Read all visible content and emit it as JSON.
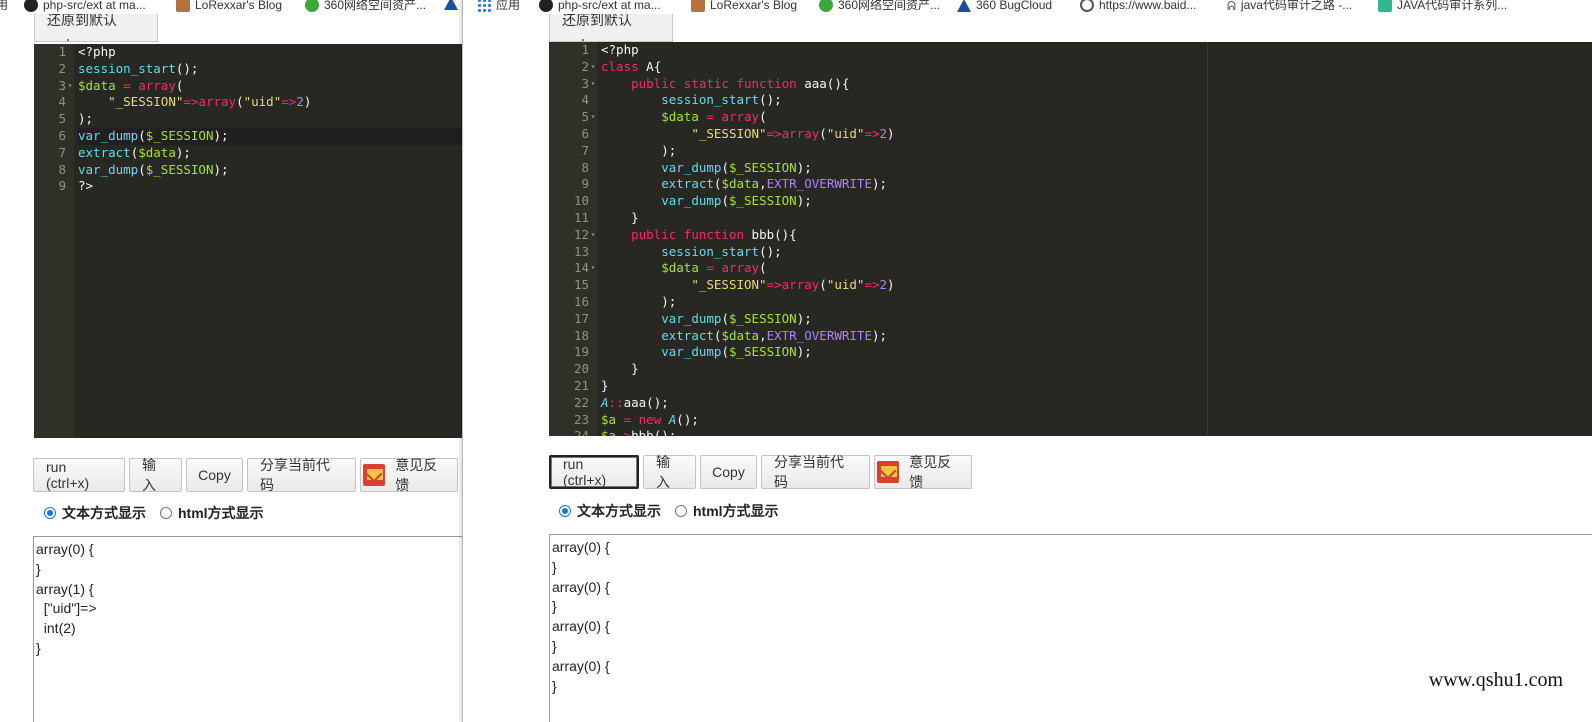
{
  "left": {
    "bookmarks": [
      {
        "label": "用",
        "icon": "none"
      },
      {
        "label": "php-src/ext at ma...",
        "icon": "github-icon"
      },
      {
        "label": "LoRexxar's Blog",
        "icon": "blog-icon"
      },
      {
        "label": "360网络空间资产...",
        "icon": "360-icon"
      },
      {
        "label": "",
        "icon": "bugcloud-icon"
      }
    ],
    "restore_label": "还原到默认code",
    "code_lines": [
      [
        {
          "t": "plain",
          "s": "<?php"
        }
      ],
      [
        {
          "t": "fn",
          "s": "session_start"
        },
        {
          "t": "plain",
          "s": "();"
        }
      ],
      [
        {
          "t": "var",
          "s": "$data"
        },
        {
          "t": "plain",
          "s": " "
        },
        {
          "t": "kw",
          "s": "="
        },
        {
          "t": "plain",
          "s": " "
        },
        {
          "t": "kw",
          "s": "array"
        },
        {
          "t": "plain",
          "s": "("
        }
      ],
      [
        {
          "t": "plain",
          "s": "    "
        },
        {
          "t": "str",
          "s": "\"_SESSION\""
        },
        {
          "t": "kw",
          "s": "=>"
        },
        {
          "t": "kw",
          "s": "array"
        },
        {
          "t": "plain",
          "s": "("
        },
        {
          "t": "str",
          "s": "\"uid\""
        },
        {
          "t": "kw",
          "s": "=>"
        },
        {
          "t": "num",
          "s": "2"
        },
        {
          "t": "plain",
          "s": ")"
        }
      ],
      [
        {
          "t": "plain",
          "s": ");"
        }
      ],
      [
        {
          "t": "fn",
          "s": "var_dump"
        },
        {
          "t": "plain",
          "s": "("
        },
        {
          "t": "var",
          "s": "$_SESSION"
        },
        {
          "t": "plain",
          "s": ");"
        }
      ],
      [
        {
          "t": "fn",
          "s": "extract"
        },
        {
          "t": "plain",
          "s": "("
        },
        {
          "t": "var",
          "s": "$data"
        },
        {
          "t": "plain",
          "s": ");"
        }
      ],
      [
        {
          "t": "fn",
          "s": "var_dump"
        },
        {
          "t": "plain",
          "s": "("
        },
        {
          "t": "var",
          "s": "$_SESSION"
        },
        {
          "t": "plain",
          "s": ");"
        }
      ],
      [
        {
          "t": "plain",
          "s": "?>"
        }
      ]
    ],
    "fold_lines": [
      3
    ],
    "active_line": 6,
    "buttons": {
      "run": "run (ctrl+x)",
      "input": "输入",
      "copy": "Copy",
      "share": "分享当前代码",
      "feedback": "意见反馈"
    },
    "radio": {
      "text": "文本方式显示",
      "html": "html方式显示",
      "selected": "text"
    },
    "output_lines": [
      "array(0) {",
      "}",
      "array(1) {",
      "  [\"uid\"]=>",
      "  int(2)",
      "}"
    ]
  },
  "right": {
    "bookmarks": [
      {
        "label": "应用",
        "icon": "apps-icon"
      },
      {
        "label": "php-src/ext at ma...",
        "icon": "github-icon"
      },
      {
        "label": "LoRexxar's Blog",
        "icon": "blog-icon"
      },
      {
        "label": "360网络空间资产...",
        "icon": "360-icon"
      },
      {
        "label": "360 BugCloud",
        "icon": "bugcloud-icon"
      },
      {
        "label": "https://www.baid...",
        "icon": "globe-icon"
      },
      {
        "label": "java代码审计之路 -...",
        "icon": "java-icon"
      },
      {
        "label": "JAVA代码审计系列...",
        "icon": "doc-icon"
      }
    ],
    "restore_label": "还原到默认code",
    "code_lines": [
      [
        {
          "t": "plain",
          "s": "<?php"
        }
      ],
      [
        {
          "t": "kw",
          "s": "class"
        },
        {
          "t": "plain",
          "s": " A{"
        }
      ],
      [
        {
          "t": "plain",
          "s": "    "
        },
        {
          "t": "kw",
          "s": "public"
        },
        {
          "t": "plain",
          "s": " "
        },
        {
          "t": "kw",
          "s": "static"
        },
        {
          "t": "plain",
          "s": " "
        },
        {
          "t": "kw",
          "s": "function"
        },
        {
          "t": "plain",
          "s": " aaa(){"
        }
      ],
      [
        {
          "t": "plain",
          "s": "        "
        },
        {
          "t": "fn",
          "s": "session_start"
        },
        {
          "t": "plain",
          "s": "();"
        }
      ],
      [
        {
          "t": "plain",
          "s": "        "
        },
        {
          "t": "var",
          "s": "$data"
        },
        {
          "t": "plain",
          "s": " "
        },
        {
          "t": "kw",
          "s": "="
        },
        {
          "t": "plain",
          "s": " "
        },
        {
          "t": "kw",
          "s": "array"
        },
        {
          "t": "plain",
          "s": "("
        }
      ],
      [
        {
          "t": "plain",
          "s": "            "
        },
        {
          "t": "str",
          "s": "\"_SESSION\""
        },
        {
          "t": "kw",
          "s": "=>"
        },
        {
          "t": "kw",
          "s": "array"
        },
        {
          "t": "plain",
          "s": "("
        },
        {
          "t": "str",
          "s": "\"uid\""
        },
        {
          "t": "kw",
          "s": "=>"
        },
        {
          "t": "num",
          "s": "2"
        },
        {
          "t": "plain",
          "s": ")"
        }
      ],
      [
        {
          "t": "plain",
          "s": "        );"
        }
      ],
      [
        {
          "t": "plain",
          "s": "        "
        },
        {
          "t": "fn",
          "s": "var_dump"
        },
        {
          "t": "plain",
          "s": "("
        },
        {
          "t": "var",
          "s": "$_SESSION"
        },
        {
          "t": "plain",
          "s": ");"
        }
      ],
      [
        {
          "t": "plain",
          "s": "        "
        },
        {
          "t": "fn",
          "s": "extract"
        },
        {
          "t": "plain",
          "s": "("
        },
        {
          "t": "var",
          "s": "$data"
        },
        {
          "t": "plain",
          "s": ","
        },
        {
          "t": "const",
          "s": "EXTR_OVERWRITE"
        },
        {
          "t": "plain",
          "s": ");"
        }
      ],
      [
        {
          "t": "plain",
          "s": "        "
        },
        {
          "t": "fn",
          "s": "var_dump"
        },
        {
          "t": "plain",
          "s": "("
        },
        {
          "t": "var",
          "s": "$_SESSION"
        },
        {
          "t": "plain",
          "s": ");"
        }
      ],
      [
        {
          "t": "plain",
          "s": "    }"
        }
      ],
      [
        {
          "t": "plain",
          "s": "    "
        },
        {
          "t": "kw",
          "s": "public"
        },
        {
          "t": "plain",
          "s": " "
        },
        {
          "t": "kw",
          "s": "function"
        },
        {
          "t": "plain",
          "s": " bbb(){"
        }
      ],
      [
        {
          "t": "plain",
          "s": "        "
        },
        {
          "t": "fn",
          "s": "session_start"
        },
        {
          "t": "plain",
          "s": "();"
        }
      ],
      [
        {
          "t": "plain",
          "s": "        "
        },
        {
          "t": "var",
          "s": "$data"
        },
        {
          "t": "plain",
          "s": " "
        },
        {
          "t": "kw",
          "s": "="
        },
        {
          "t": "plain",
          "s": " "
        },
        {
          "t": "kw",
          "s": "array"
        },
        {
          "t": "plain",
          "s": "("
        }
      ],
      [
        {
          "t": "plain",
          "s": "            "
        },
        {
          "t": "str",
          "s": "\"_SESSION\""
        },
        {
          "t": "kw",
          "s": "=>"
        },
        {
          "t": "kw",
          "s": "array"
        },
        {
          "t": "plain",
          "s": "("
        },
        {
          "t": "str",
          "s": "\"uid\""
        },
        {
          "t": "kw",
          "s": "=>"
        },
        {
          "t": "num",
          "s": "2"
        },
        {
          "t": "plain",
          "s": ")"
        }
      ],
      [
        {
          "t": "plain",
          "s": "        );"
        }
      ],
      [
        {
          "t": "plain",
          "s": "        "
        },
        {
          "t": "fn",
          "s": "var_dump"
        },
        {
          "t": "plain",
          "s": "("
        },
        {
          "t": "var",
          "s": "$_SESSION"
        },
        {
          "t": "plain",
          "s": ");"
        }
      ],
      [
        {
          "t": "plain",
          "s": "        "
        },
        {
          "t": "fn",
          "s": "extract"
        },
        {
          "t": "plain",
          "s": "("
        },
        {
          "t": "var",
          "s": "$data"
        },
        {
          "t": "plain",
          "s": ","
        },
        {
          "t": "const",
          "s": "EXTR_OVERWRITE"
        },
        {
          "t": "plain",
          "s": ");"
        }
      ],
      [
        {
          "t": "plain",
          "s": "        "
        },
        {
          "t": "fn",
          "s": "var_dump"
        },
        {
          "t": "plain",
          "s": "("
        },
        {
          "t": "var",
          "s": "$_SESSION"
        },
        {
          "t": "plain",
          "s": ");"
        }
      ],
      [
        {
          "t": "plain",
          "s": "    }"
        }
      ],
      [
        {
          "t": "plain",
          "s": "}"
        }
      ],
      [
        {
          "t": "cls",
          "s": "A"
        },
        {
          "t": "kw",
          "s": "::"
        },
        {
          "t": "plain",
          "s": "aaa();"
        }
      ],
      [
        {
          "t": "var",
          "s": "$a"
        },
        {
          "t": "plain",
          "s": " "
        },
        {
          "t": "kw",
          "s": "="
        },
        {
          "t": "plain",
          "s": " "
        },
        {
          "t": "kw",
          "s": "new"
        },
        {
          "t": "plain",
          "s": " "
        },
        {
          "t": "cls",
          "s": "A"
        },
        {
          "t": "plain",
          "s": "();"
        }
      ],
      [
        {
          "t": "var",
          "s": "$a"
        },
        {
          "t": "kw",
          "s": "->"
        },
        {
          "t": "plain",
          "s": "bbb();"
        }
      ]
    ],
    "fold_lines": [
      2,
      3,
      5,
      12,
      14
    ],
    "active_line": 0,
    "buttons": {
      "run": "run (ctrl+x)",
      "input": "输入",
      "copy": "Copy",
      "share": "分享当前代码",
      "feedback": "意见反馈"
    },
    "radio": {
      "text": "文本方式显示",
      "html": "html方式显示",
      "selected": "text"
    },
    "output_lines": [
      "array(0) {",
      "}",
      "array(0) {",
      "}",
      "array(0) {",
      "}",
      "array(0) {",
      "}"
    ]
  },
  "watermark": "www.qshu1.com",
  "colors": {
    "editor_bg": "#272822",
    "gutter_bg": "#2f3129",
    "keyword": "#f92672",
    "function": "#66d9ef",
    "variable": "#a6e22e",
    "string": "#e6db74",
    "number": "#ae81ff"
  }
}
